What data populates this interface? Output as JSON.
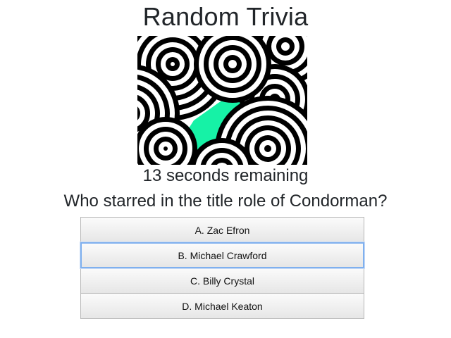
{
  "page": {
    "title": "Random Trivia",
    "timer_text": "13 seconds remaining",
    "question": "Who starred in the title role of Condorman?"
  },
  "answers": [
    {
      "label": "A. Zac Efron"
    },
    {
      "label": "B. Michael Crawford"
    },
    {
      "label": "C. Billy Crystal"
    },
    {
      "label": "D. Michael Keaton"
    }
  ],
  "image": {
    "icon": "concentric-circles-pattern",
    "colors": {
      "stroke": "#000000",
      "fill": "#ffffff",
      "accent": "#16f2a6"
    }
  }
}
